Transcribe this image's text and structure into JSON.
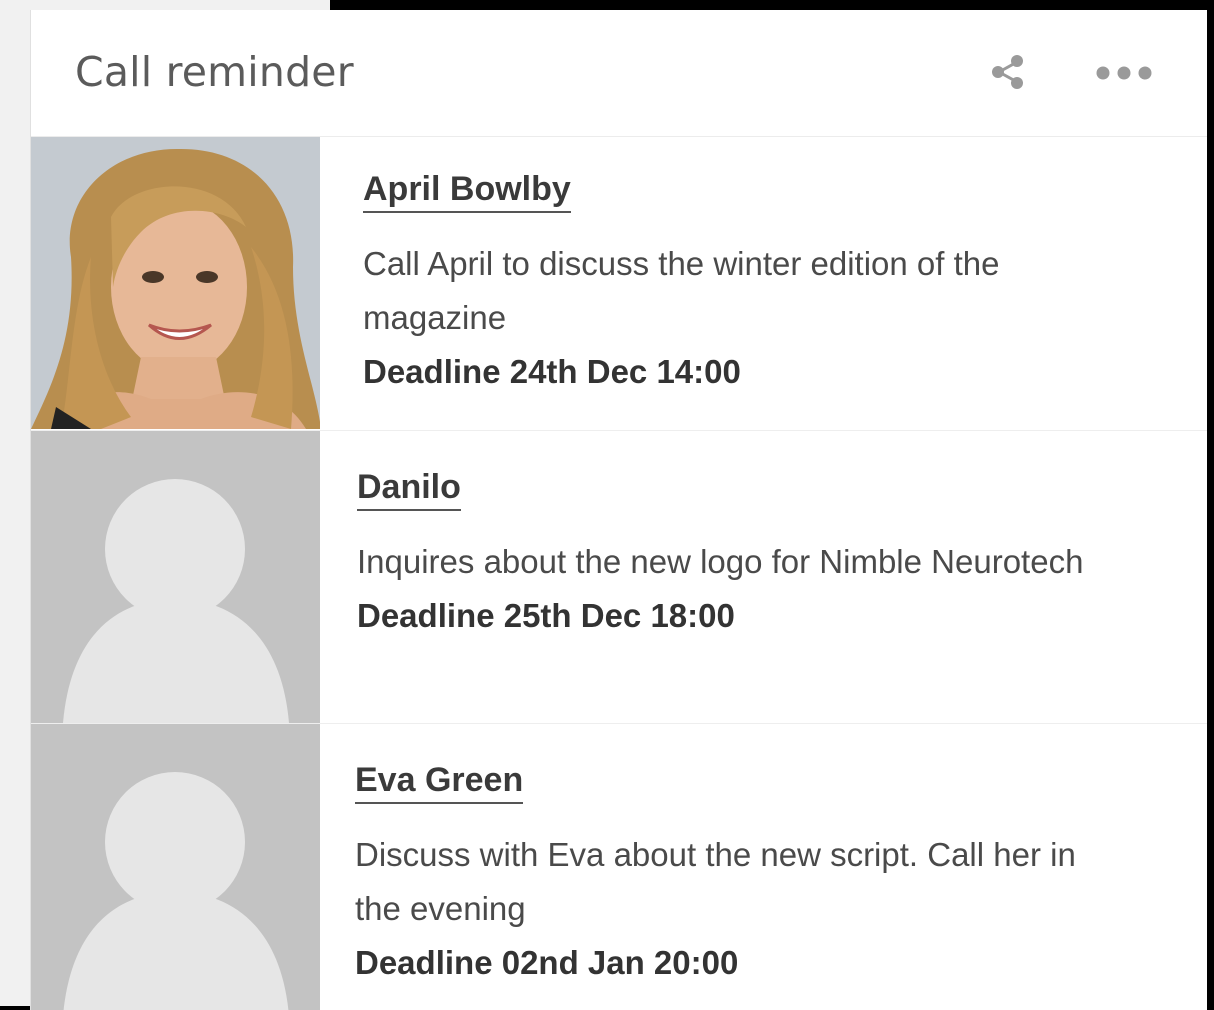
{
  "header": {
    "title": "Call reminder",
    "share_icon": "share-icon",
    "more_icon": "more-horizontal-icon"
  },
  "reminders": [
    {
      "name": "April Bowlby",
      "description": "Call April to discuss the winter edition of the magazine",
      "deadline": "Deadline 24th Dec 14:00",
      "avatar": "photo"
    },
    {
      "name": "Danilo",
      "description": "Inquires about the new logo for Nimble Neurotech",
      "deadline": "Deadline 25th Dec 18:00",
      "avatar": "placeholder-person-icon"
    },
    {
      "name": "Eva Green",
      "description": "Discuss with Eva about the new script. Call her in the evening",
      "deadline": "Deadline 02nd Jan 20:00",
      "avatar": "placeholder-person-icon"
    }
  ],
  "colors": {
    "avatar_placeholder_bg": "#c3c3c3",
    "avatar_placeholder_fg": "#e6e6e6",
    "title": "#5b5b5b",
    "icon": "#9a9a9a"
  }
}
